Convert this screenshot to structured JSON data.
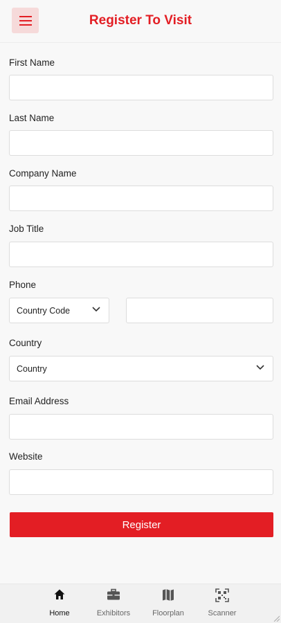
{
  "header": {
    "title": "Register To Visit",
    "menu_icon": "hamburger-menu-icon"
  },
  "form": {
    "first_name_label": "First Name",
    "last_name_label": "Last Name",
    "company_label": "Company Name",
    "job_title_label": "Job Title",
    "phone_label": "Phone",
    "country_code_placeholder": "Country Code",
    "country_label": "Country",
    "country_placeholder": "Country",
    "email_label": "Email Address",
    "website_label": "Website",
    "register_label": "Register"
  },
  "tabs": [
    {
      "label": "Home",
      "icon": "home-icon",
      "active": true
    },
    {
      "label": "Exhibitors",
      "icon": "briefcase-icon",
      "active": false
    },
    {
      "label": "Floorplan",
      "icon": "map-icon",
      "active": false
    },
    {
      "label": "Scanner",
      "icon": "qr-scanner-icon",
      "active": false
    }
  ],
  "colors": {
    "accent": "#e31e24",
    "menu_bg": "#f6dada",
    "background": "#f8f8f8"
  }
}
